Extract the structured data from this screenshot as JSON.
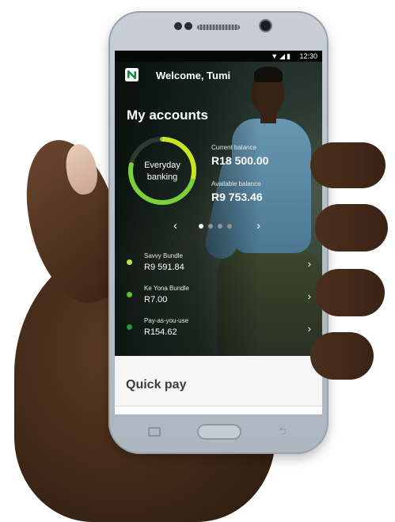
{
  "status_bar": {
    "time": "12:30",
    "icons": "▼◢▮"
  },
  "header": {
    "welcome": "Welcome, Tumi"
  },
  "accounts": {
    "title": "My accounts",
    "ring_label_line1": "Everyday",
    "ring_label_line2": "banking",
    "current_balance_label": "Current balance",
    "current_balance_value": "R18 500.00",
    "available_balance_label": "Available balance",
    "available_balance_value": "R9 753.46",
    "carousel": {
      "left_arrow": "‹",
      "right_arrow": "›",
      "page_count": 4,
      "active_index": 0
    },
    "list": [
      {
        "name": "Savvy Bundle",
        "value": "R9 591.84",
        "color": "#b8e24a"
      },
      {
        "name": "Ke Yona Bundle",
        "value": "R7.00",
        "color": "#5fc13a"
      },
      {
        "name": "Pay-as-you-use",
        "value": "R154.62",
        "color": "#1e9a3a"
      }
    ],
    "chevron": "›"
  },
  "quick_pay": {
    "title": "Quick pay"
  },
  "colors": {
    "ring_outer": "#7bd13a",
    "ring_inner": "#c8e620",
    "brand_green": "#0a8f3c"
  }
}
